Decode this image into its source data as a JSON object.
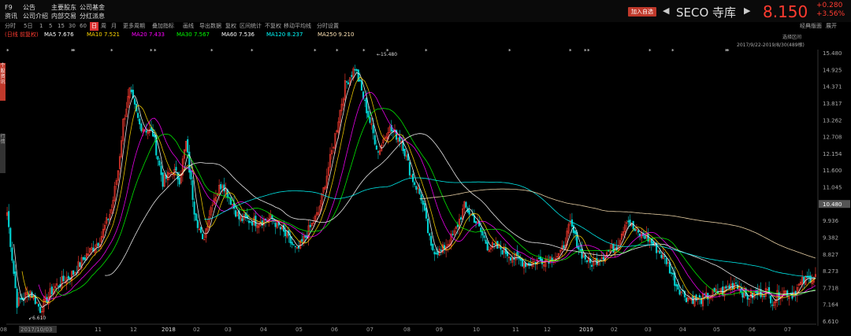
{
  "menu": {
    "col1": [
      "F9",
      "资讯"
    ],
    "col2": [
      "公告",
      "公司介绍"
    ],
    "col3": [
      "主要股东",
      "内部交易"
    ],
    "col4": [
      "公司基金",
      "分红派息"
    ]
  },
  "header": {
    "add_watchlist": "加入自选",
    "stock_name": "SECO 寺库",
    "price": "8.150",
    "change": "+0.280",
    "change_pct": "+3.56%",
    "nav_prev": "◀",
    "nav_next": "▶"
  },
  "toolbar": {
    "items": [
      "分时",
      "5日",
      "1",
      "5",
      "15",
      "30",
      "60",
      "日",
      "周",
      "月",
      "更多周期",
      "叠加指标",
      "画线",
      "导出数据",
      "复权",
      "区间统计",
      "不复权",
      "移动平均线",
      "分时设置"
    ],
    "active": "日",
    "right": [
      "经典版面",
      "展开"
    ]
  },
  "ma_bar": {
    "type_label": "(日线 前复权)",
    "ma5": "MA5 7.676",
    "ma10": "MA10 7.521",
    "ma20": "MA20 7.433",
    "ma30": "MA30 7.567",
    "ma60": "MA60 7.536",
    "ma120": "MA120 8.237",
    "ma250": "MA250 9.210"
  },
  "side_tabs": [
    "个股资讯",
    "行情"
  ],
  "right_top": {
    "line1": "选择区间",
    "line2": "2017/9/22-2019/8/30(489根)"
  },
  "colors": {
    "up": "#ff3b30",
    "down": "#00d4d4",
    "ma5": "#ffffff",
    "ma10": "#ffd700",
    "ma20": "#ff00ff",
    "ma30": "#00ff00",
    "ma60": "#ffffff",
    "ma120": "#00ffff",
    "ma250": "#ffe4b5",
    "last_price_tag": "#555555"
  },
  "chart_data": {
    "type": "candlestick",
    "ylim": [
      6.61,
      15.48
    ],
    "y_ticks": [
      "15.480",
      "14.925",
      "14.371",
      "13.817",
      "13.262",
      "12.708",
      "12.154",
      "11.600",
      "11.045",
      "10.491",
      "9.936",
      "9.382",
      "8.827",
      "8.273",
      "7.718",
      "7.164",
      "6.610"
    ],
    "x_ticks": [
      "2017/10/03",
      "11",
      "12",
      "2018",
      "02",
      "03",
      "04",
      "05",
      "06",
      "07",
      "08",
      "09",
      "10",
      "11",
      "12",
      "2019",
      "02",
      "03",
      "04",
      "05",
      "06",
      "07",
      "08"
    ],
    "max_label": "15.480",
    "min_label": "6.610",
    "last_price_label": "10.480",
    "close_anchors": [
      [
        0,
        10.2
      ],
      [
        6,
        7.2
      ],
      [
        14,
        7.6
      ],
      [
        20,
        7.0
      ],
      [
        28,
        7.7
      ],
      [
        40,
        8.2
      ],
      [
        48,
        8.8
      ],
      [
        56,
        9.3
      ],
      [
        63,
        10.3
      ],
      [
        67,
        11.6
      ],
      [
        70,
        13.2
      ],
      [
        74,
        14.2
      ],
      [
        80,
        13.1
      ],
      [
        88,
        12.8
      ],
      [
        94,
        11.2
      ],
      [
        100,
        11.6
      ],
      [
        104,
        11.3
      ],
      [
        108,
        12.5
      ],
      [
        113,
        10.3
      ],
      [
        118,
        9.2
      ],
      [
        124,
        10.6
      ],
      [
        130,
        11.2
      ],
      [
        140,
        10.0
      ],
      [
        150,
        9.9
      ],
      [
        160,
        10.0
      ],
      [
        170,
        9.3
      ],
      [
        175,
        8.9
      ],
      [
        180,
        9.4
      ],
      [
        188,
        10.2
      ],
      [
        196,
        12.2
      ],
      [
        204,
        14.4
      ],
      [
        210,
        15.0
      ],
      [
        218,
        13.4
      ],
      [
        224,
        12.2
      ],
      [
        230,
        13.0
      ],
      [
        238,
        12.6
      ],
      [
        244,
        11.4
      ],
      [
        250,
        10.7
      ],
      [
        256,
        9.0
      ],
      [
        262,
        8.9
      ],
      [
        270,
        9.5
      ],
      [
        276,
        10.4
      ],
      [
        282,
        10.0
      ],
      [
        290,
        9.1
      ],
      [
        298,
        9.0
      ],
      [
        306,
        8.7
      ],
      [
        314,
        8.5
      ],
      [
        320,
        8.6
      ],
      [
        328,
        8.7
      ],
      [
        334,
        8.8
      ],
      [
        340,
        9.8
      ],
      [
        346,
        8.9
      ],
      [
        352,
        8.5
      ],
      [
        360,
        8.8
      ],
      [
        368,
        9.1
      ],
      [
        374,
        10.0
      ],
      [
        380,
        9.5
      ],
      [
        386,
        9.4
      ],
      [
        392,
        9.0
      ],
      [
        398,
        8.6
      ],
      [
        404,
        7.8
      ],
      [
        410,
        7.4
      ],
      [
        418,
        7.3
      ],
      [
        426,
        7.5
      ],
      [
        432,
        7.6
      ],
      [
        440,
        7.9
      ],
      [
        446,
        7.4
      ],
      [
        452,
        7.5
      ],
      [
        458,
        7.6
      ],
      [
        462,
        7.3
      ],
      [
        468,
        7.6
      ],
      [
        474,
        7.5
      ],
      [
        480,
        7.9
      ],
      [
        488,
        8.15
      ]
    ],
    "star_markers": [
      8,
      90,
      92,
      140,
      190,
      195,
      267,
      318,
      398,
      426,
      460,
      490,
      539,
      645,
      722,
      741,
      745,
      823,
      852,
      920,
      922
    ]
  }
}
